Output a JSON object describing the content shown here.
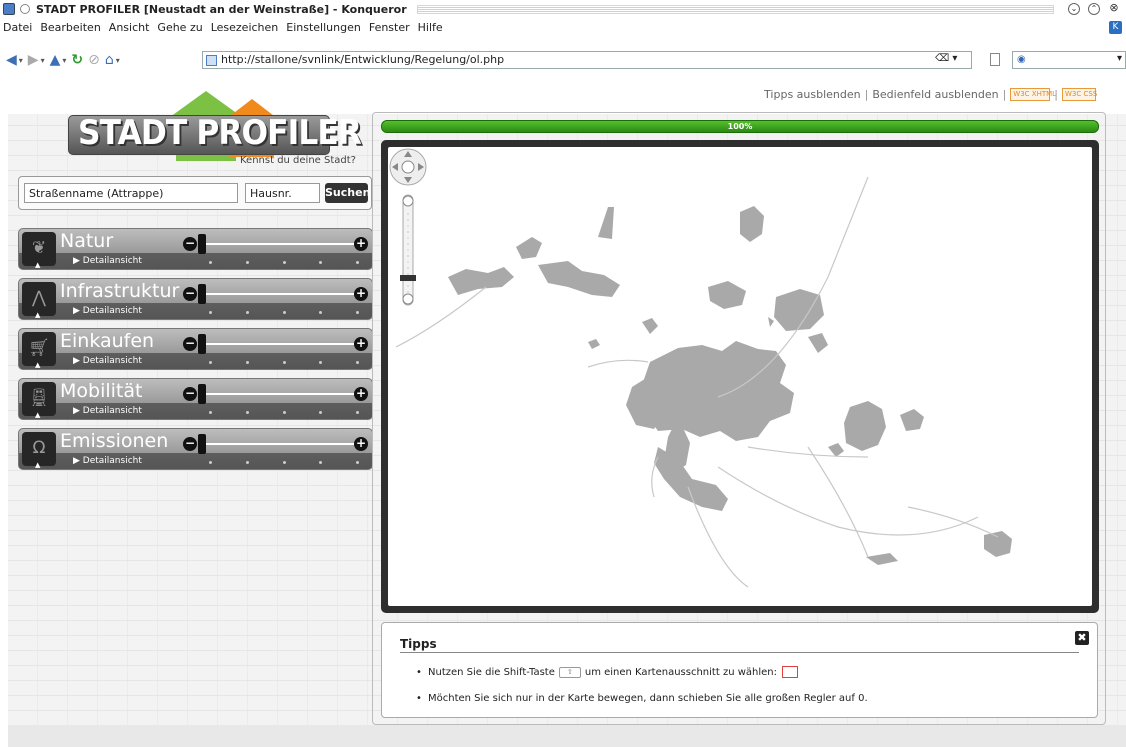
{
  "window": {
    "title": "STADT PROFILER [Neustadt an der Weinstraße] - Konqueror"
  },
  "menu": [
    "Datei",
    "Bearbeiten",
    "Ansicht",
    "Gehe zu",
    "Lesezeichen",
    "Einstellungen",
    "Fenster",
    "Hilfe"
  ],
  "toolbar": {
    "url": "http://stallone/svnlink/Entwicklung/Regelung/ol.php"
  },
  "header": {
    "tips_toggle": "Tipps ausblenden",
    "panel_toggle": "Bedienfeld ausblenden",
    "badge1": "W3C XHTML",
    "badge2": "W3C CSS"
  },
  "logo": {
    "word": "STADT PROFILER",
    "tagline": "Kennst du deine Stadt?"
  },
  "search": {
    "street_value": "Straßenname (Attrappe)",
    "number_value": "Hausnr.",
    "button": "Suchen"
  },
  "categories": [
    {
      "label": "Natur",
      "detail": "▶ Detailansicht",
      "value": 0
    },
    {
      "label": "Infrastruktur",
      "detail": "▶ Detailansicht",
      "value": 0
    },
    {
      "label": "Einkaufen",
      "detail": "▶ Detailansicht",
      "value": 0
    },
    {
      "label": "Mobilität",
      "detail": "▶ Detailansicht",
      "value": 0
    },
    {
      "label": "Emissionen",
      "detail": "▶ Detailansicht",
      "value": 0
    }
  ],
  "progress": {
    "value": 1.0,
    "label": "100%"
  },
  "tips": {
    "heading": "Tipps",
    "item1_before": "Nutzen Sie die Shift-Taste",
    "item1_after": "um einen Kartenausschnitt zu wählen:",
    "item2": "Möchten Sie sich nur in der Karte bewegen, dann schieben Sie alle großen Regler auf 0."
  },
  "colors": {
    "progress_green": "#2f9a17",
    "map_frame": "#2e2e2e",
    "logo_green": "#7cc143",
    "logo_orange": "#f08a1c"
  }
}
